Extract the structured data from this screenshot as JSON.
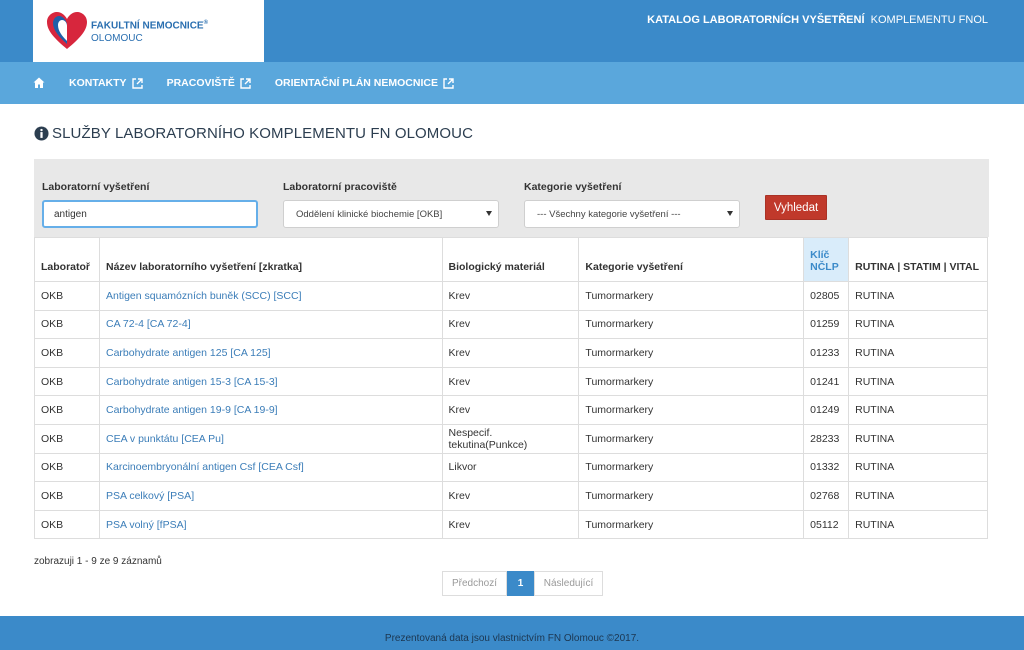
{
  "header": {
    "logo_line1": "FAKULTNÍ NEMOCNICE",
    "logo_reg": "®",
    "logo_line2": "OLOMOUC",
    "title_bold": "KATALOG LABORATORNÍCH VYŠETŘENÍ",
    "title_rest": "KOMPLEMENTU FNOL"
  },
  "nav": {
    "home_icon": "home-icon",
    "items": [
      {
        "label": "KONTAKTY"
      },
      {
        "label": "PRACOVIŠTĚ"
      },
      {
        "label": "ORIENTAČNÍ PLÁN NEMOCNICE"
      }
    ]
  },
  "page": {
    "title": "SLUŽBY LABORATORNÍHO KOMPLEMENTU FN OLOMOUC"
  },
  "filters": {
    "exam_label": "Laboratorní vyšetření",
    "exam_value": "antigen",
    "lab_label": "Laboratorní pracoviště",
    "lab_value": "Oddělení klinické biochemie [OKB]",
    "category_label": "Kategorie vyšetření",
    "category_value": "--- Všechny kategorie vyšetření ---",
    "search_button": "Vyhledat"
  },
  "table": {
    "headers": {
      "lab": "Laboratoř",
      "name": "Název laboratorního vyšetření [zkratka]",
      "material": "Biologický materiál",
      "category": "Kategorie vyšetření",
      "key_line1": "Klíč",
      "key_line2": "NČLP",
      "routine": "RUTINA | STATIM | VITAL"
    },
    "rows": [
      {
        "lab": "OKB",
        "name": "Antigen squamózních buněk (SCC) [SCC]",
        "material": "Krev",
        "category": "Tumormarkery",
        "key": "02805",
        "routine": "RUTINA"
      },
      {
        "lab": "OKB",
        "name": "CA 72-4 [CA 72-4]",
        "material": "Krev",
        "category": "Tumormarkery",
        "key": "01259",
        "routine": "RUTINA"
      },
      {
        "lab": "OKB",
        "name": "Carbohydrate antigen 125 [CA 125]",
        "material": "Krev",
        "category": "Tumormarkery",
        "key": "01233",
        "routine": "RUTINA"
      },
      {
        "lab": "OKB",
        "name": "Carbohydrate antigen 15-3 [CA 15-3]",
        "material": "Krev",
        "category": "Tumormarkery",
        "key": "01241",
        "routine": "RUTINA"
      },
      {
        "lab": "OKB",
        "name": "Carbohydrate antigen 19-9 [CA 19-9]",
        "material": "Krev",
        "category": "Tumormarkery",
        "key": "01249",
        "routine": "RUTINA"
      },
      {
        "lab": "OKB",
        "name": "CEA v punktátu [CEA Pu]",
        "material": "Nespecif. tekutina(Punkce)",
        "category": "Tumormarkery",
        "key": "28233",
        "routine": "RUTINA"
      },
      {
        "lab": "OKB",
        "name": "Karcinoembryonální antigen Csf [CEA Csf]",
        "material": "Likvor",
        "category": "Tumormarkery",
        "key": "01332",
        "routine": "RUTINA"
      },
      {
        "lab": "OKB",
        "name": "PSA celkový [PSA]",
        "material": "Krev",
        "category": "Tumormarkery",
        "key": "02768",
        "routine": "RUTINA"
      },
      {
        "lab": "OKB",
        "name": "PSA volný [fPSA]",
        "material": "Krev",
        "category": "Tumormarkery",
        "key": "05112",
        "routine": "RUTINA"
      }
    ]
  },
  "pagination": {
    "records_text": "zobrazuji 1 - 9 ze 9 záznamů",
    "prev": "Předchozí",
    "current": "1",
    "next": "Následující"
  },
  "footer": {
    "text": "Prezentovaná data jsou vlastnictvím FN Olomouc ©2017."
  },
  "colors": {
    "primary": "#3b8ac9",
    "nav": "#5aa7dc",
    "button": "#c0392b",
    "link": "#3b7db8"
  }
}
